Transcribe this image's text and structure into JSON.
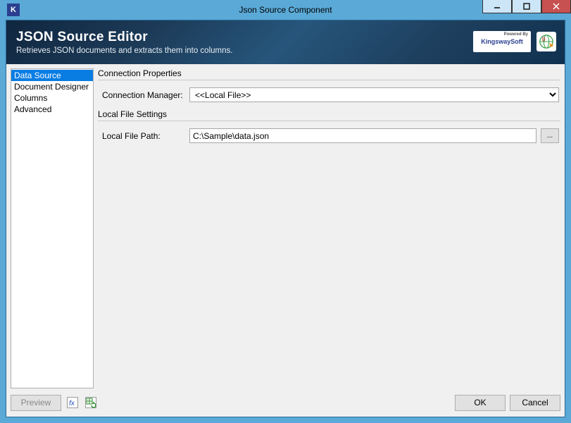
{
  "window": {
    "title": "Json Source Component"
  },
  "header": {
    "title": "JSON Source Editor",
    "subtitle": "Retrieves JSON documents and extracts them into columns.",
    "powered_by": "Powered By",
    "brand": "KingswaySoft"
  },
  "sidebar": {
    "items": [
      {
        "label": "Data Source",
        "active": true
      },
      {
        "label": "Document Designer",
        "active": false
      },
      {
        "label": "Columns",
        "active": false
      },
      {
        "label": "Advanced",
        "active": false
      }
    ]
  },
  "content": {
    "group1": {
      "title": "Connection Properties",
      "conn_manager_label": "Connection Manager:",
      "conn_manager_value": "<<Local File>>"
    },
    "group2": {
      "title": "Local File Settings",
      "filepath_label": "Local File Path:",
      "filepath_value": "C:\\Sample\\data.json",
      "browse_label": "..."
    }
  },
  "footer": {
    "preview": "Preview",
    "ok": "OK",
    "cancel": "Cancel"
  }
}
